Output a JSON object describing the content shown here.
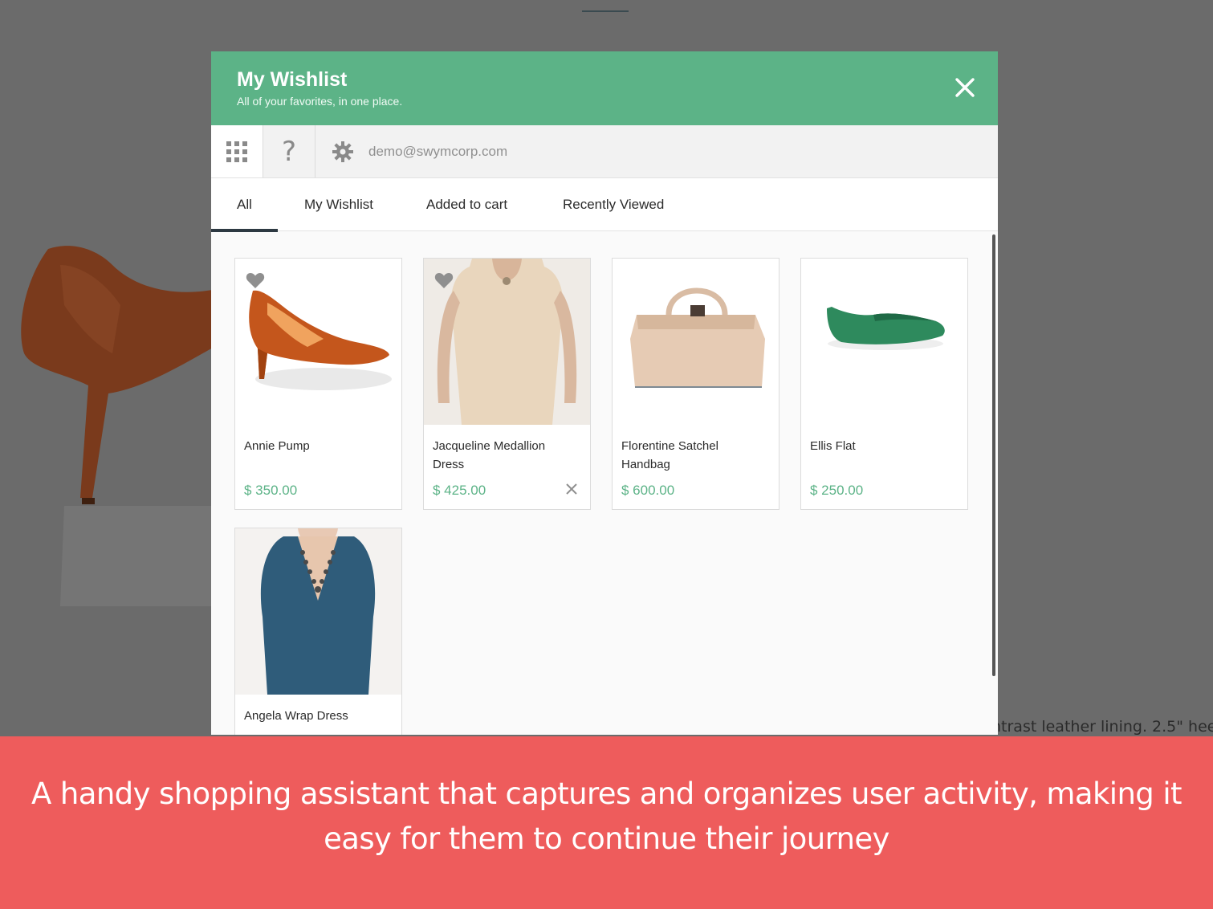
{
  "background": {
    "product_description": "ntrast leather lining. 2.5\" hee"
  },
  "wishlist": {
    "title": "My Wishlist",
    "subtitle": "All of your favorites, in one place.",
    "close_icon": "close-icon",
    "toolbar": {
      "grid_icon": "grid-icon",
      "help_label": "?",
      "settings_icon": "gear-icon",
      "email": "demo@swymcorp.com"
    },
    "tabs": [
      {
        "label": "All",
        "active": true
      },
      {
        "label": "My Wishlist",
        "active": false
      },
      {
        "label": "Added to cart",
        "active": false
      },
      {
        "label": "Recently Viewed",
        "active": false
      }
    ],
    "products": [
      {
        "name": "Annie Pump",
        "price": "$ 350.00",
        "favorited": true
      },
      {
        "name": "Jacqueline Medallion Dress",
        "price": "$ 425.00",
        "favorited": true
      },
      {
        "name": "Florentine Satchel Handbag",
        "price": "$ 600.00",
        "favorited": false
      },
      {
        "name": "Ellis Flat",
        "price": "$ 250.00",
        "favorited": false
      },
      {
        "name": "Angela Wrap Dress",
        "price": "",
        "favorited": false
      }
    ]
  },
  "banner": {
    "text": "A handy shopping assistant that captures and organizes user activity, making it easy for them to continue their journey"
  },
  "colors": {
    "header_green": "#5cb387",
    "price_green": "#5cb387",
    "banner_red": "#ee5c5c",
    "overlay": "#6b6b6b"
  }
}
